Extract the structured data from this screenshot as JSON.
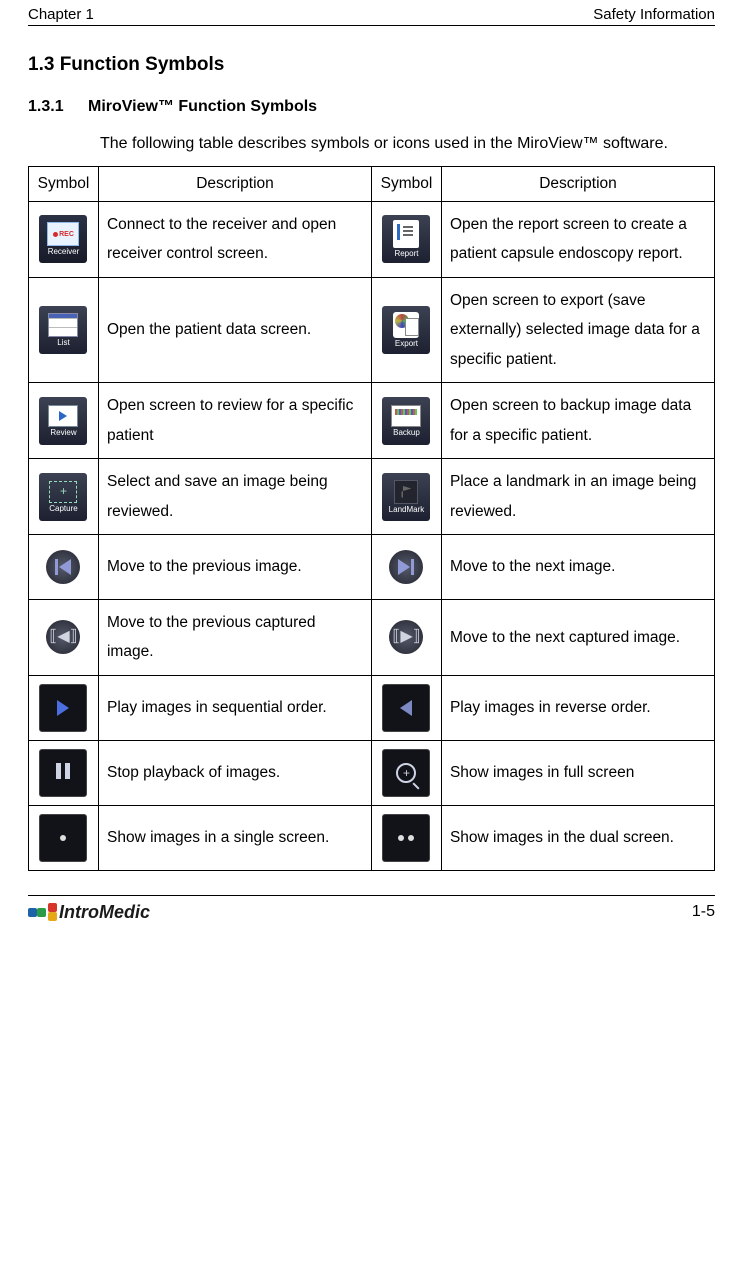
{
  "header": {
    "left": "Chapter 1",
    "right": "Safety Information"
  },
  "section": {
    "number": "1.3",
    "title": "Function Symbols"
  },
  "subsection": {
    "number": "1.3.1",
    "title": "MiroView™ Function Symbols"
  },
  "intro": "The following table describes symbols or icons used in the MiroView™ software.",
  "table": {
    "headers": {
      "symbol": "Symbol",
      "description": "Description"
    },
    "rows": [
      {
        "left_icon": "receiver-icon",
        "left_desc": "Connect to the receiver and open receiver control screen.",
        "right_icon": "report-icon",
        "right_desc": "Open the report screen to create a patient capsule endoscopy report."
      },
      {
        "left_icon": "list-icon",
        "left_desc": "Open the patient data screen.",
        "right_icon": "export-icon",
        "right_desc": "Open screen to export (save externally) selected image data for a specific patient."
      },
      {
        "left_icon": "review-icon",
        "left_desc": "Open screen to review for a specific patient",
        "right_icon": "backup-icon",
        "right_desc": "Open screen to backup image data for a specific patient."
      },
      {
        "left_icon": "capture-icon",
        "left_desc": "Select and save an image being reviewed.",
        "right_icon": "landmark-icon",
        "right_desc": "Place a landmark in an image being reviewed."
      },
      {
        "left_icon": "prev-image-icon",
        "left_desc": "Move to the previous image.",
        "right_icon": "next-image-icon",
        "right_desc": "Move to the next image."
      },
      {
        "left_icon": "prev-captured-icon",
        "left_desc": "Move to the previous captured image.",
        "right_icon": "next-captured-icon",
        "right_desc": "Move to the next captured image."
      },
      {
        "left_icon": "play-forward-icon",
        "left_desc": "Play images in sequential order.",
        "right_icon": "play-reverse-icon",
        "right_desc": "Play images in reverse order."
      },
      {
        "left_icon": "pause-icon",
        "left_desc": "Stop playback of images.",
        "right_icon": "fullscreen-icon",
        "right_desc": "Show images in full screen"
      },
      {
        "left_icon": "single-screen-icon",
        "left_desc": "Show images in a single screen.",
        "right_icon": "dual-screen-icon",
        "right_desc": "Show images in the dual screen."
      }
    ]
  },
  "icon_captions": {
    "receiver": "Receiver",
    "report": "Report",
    "list": "List",
    "export": "Export",
    "review": "Review",
    "backup": "Backup",
    "capture": "Capture",
    "landmark": "LandMark"
  },
  "footer": {
    "logo": "IntroMedic",
    "page": "1-5"
  }
}
